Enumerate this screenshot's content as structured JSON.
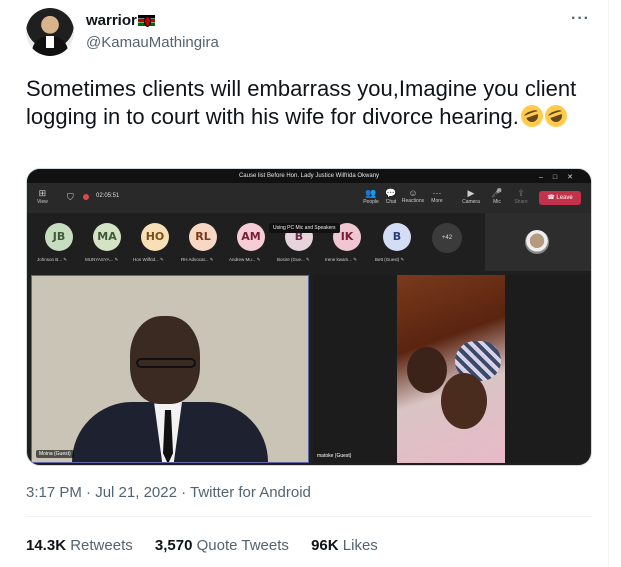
{
  "author": {
    "display_name": "warrior",
    "handle": "@KamauMathingira"
  },
  "tweet": {
    "text": "Sometimes clients will embarrass you,Imagine you client logging in to court with his wife for divorce hearing."
  },
  "media": {
    "window_title": "Cause list Before Hon. Lady Justice Wilfrida Okwany",
    "toolbar": {
      "view_label": "View",
      "timer": "02:05:51",
      "people_label": "People",
      "chat_label": "Chat",
      "reactions_label": "Reactions",
      "more_label": "More",
      "camera_label": "Camera",
      "mic_label": "Mic",
      "share_label": "Share",
      "leave_label": "Leave"
    },
    "tooltip": "Using PC Mic and Speakers",
    "participants": [
      {
        "initials": "JB",
        "label": "Johnson B...",
        "color": "#c7ddc0",
        "text_color": "#3e5a36"
      },
      {
        "initials": "MA",
        "label": "MUNYASYA...",
        "color": "#d3e3c4",
        "text_color": "#3e5a36"
      },
      {
        "initials": "HO",
        "label": "Hon Wilfrid...",
        "color": "#f7dfb8",
        "text_color": "#7a4f16"
      },
      {
        "initials": "RL",
        "label": "RH Advocat...",
        "color": "#f8d7c4",
        "text_color": "#7a3a1c"
      },
      {
        "initials": "AM",
        "label": "Andrew Mu...",
        "color": "#f6cdd6",
        "text_color": "#7a1f33"
      },
      {
        "initials": "B",
        "label": "Bosire (Gue...",
        "color": "#e7d3dc",
        "text_color": "#6b2a44"
      },
      {
        "initials": "IK",
        "label": "Irene kwam...",
        "color": "#efc6d2",
        "text_color": "#7a1f33"
      },
      {
        "initials": "B",
        "label": "Bett (Guest)",
        "color": "#d3def5",
        "text_color": "#2a3f7a"
      }
    ],
    "more_participants": "+42",
    "left_video_name": "Moina (Guest)",
    "right_video_name": "matoke (Guest)"
  },
  "meta": {
    "time": "3:17 PM",
    "date": "Jul 21, 2022",
    "source": "Twitter for Android"
  },
  "stats": {
    "retweets_count": "14.3K",
    "retweets_label": "Retweets",
    "quotes_count": "3,570",
    "quotes_label": "Quote Tweets",
    "likes_count": "96K",
    "likes_label": "Likes"
  }
}
